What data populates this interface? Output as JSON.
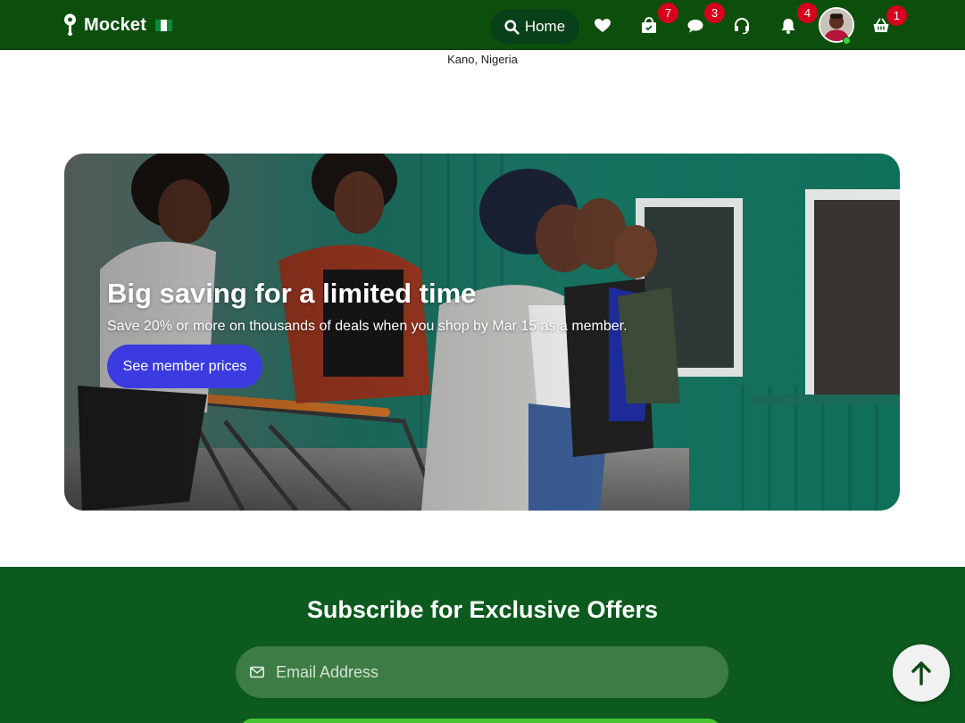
{
  "navbar": {
    "brand_name": "Mocket",
    "home_label": "Home",
    "icons": [
      "pin-icon",
      "search-icon",
      "heart-icon",
      "shopping-bag-icon",
      "chat-icon",
      "support-headset-icon",
      "bell-icon",
      "basket-icon"
    ],
    "badges": {
      "orders": "7",
      "messages": "3",
      "notifications": "4",
      "cart": "1"
    }
  },
  "location": "Kano, Nigeria",
  "hero": {
    "title": "Big saving for a limited time",
    "subtitle": "Save 20% or more on thousands of deals when you shop by Mar 15 as a member.",
    "button_label": "See member prices"
  },
  "subscribe": {
    "title": "Subscribe for Exclusive Offers",
    "email_placeholder": "Email Address"
  },
  "colors": {
    "navbar_bg": "#0c4f0c",
    "badge": "#d6001c",
    "hero_button": "#3b3be0",
    "subscribe_bg": "#0c5a1e",
    "subscribe_button": "#46c431"
  }
}
